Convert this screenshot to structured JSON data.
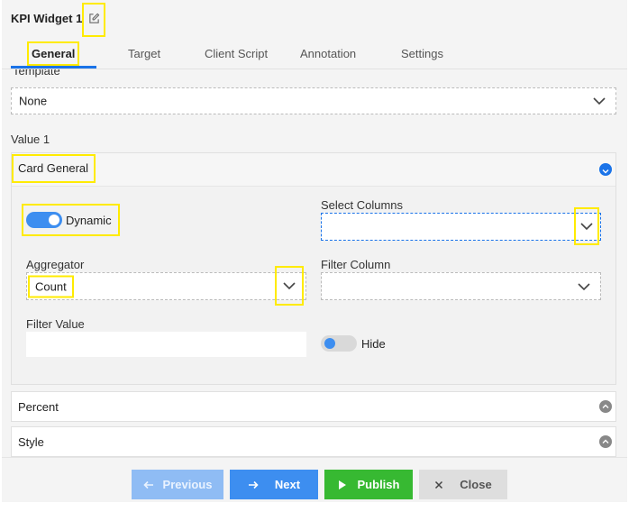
{
  "window": {
    "title": "KPI Widget 1"
  },
  "tabs": [
    {
      "label": "General",
      "active": true
    },
    {
      "label": "Target"
    },
    {
      "label": "Client Script"
    },
    {
      "label": "Annotation"
    },
    {
      "label": "Settings"
    }
  ],
  "template": {
    "label": "Template",
    "value": "None"
  },
  "value1": {
    "label": "Value 1"
  },
  "card_general": {
    "title": "Card General",
    "dynamic": {
      "label": "Dynamic",
      "on": true
    },
    "select_columns": {
      "label": "Select Columns",
      "value": ""
    },
    "aggregator": {
      "label": "Aggregator",
      "value": "Count"
    },
    "filter_column": {
      "label": "Filter Column",
      "value": ""
    },
    "filter_value": {
      "label": "Filter Value",
      "value": ""
    },
    "hide": {
      "label": "Hide",
      "on": false
    }
  },
  "sections": [
    {
      "title": "Percent"
    },
    {
      "title": "Style"
    }
  ],
  "footer": {
    "previous": "Previous",
    "next": "Next",
    "publish": "Publish",
    "close": "Close"
  },
  "colors": {
    "accent": "#1a73e8",
    "next_button": "#3d8ef0",
    "previous_button": "#8fbcf4",
    "publish_button": "#37b932",
    "close_button": "#dedede",
    "highlight": "#ffeb00"
  }
}
